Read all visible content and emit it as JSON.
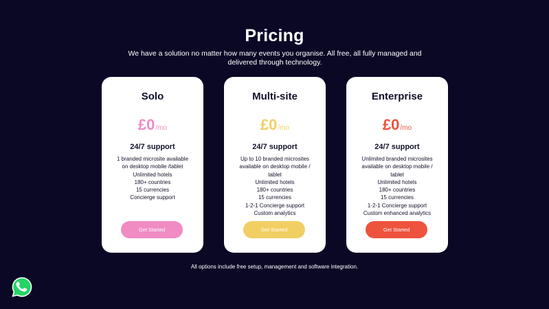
{
  "header": {
    "title": "Pricing",
    "subtitle": "We have a solution no matter how many events you organise. All free, all fully managed and delivered through technology."
  },
  "plans": [
    {
      "name": "Solo",
      "price": "£0",
      "period": "/mo",
      "support": "24/7 support",
      "accent": "#f08bc4",
      "features": [
        "1 branded microsite available",
        "on desktop mobile /tablet",
        "Unlimited hotels",
        "180+ countries",
        "15 currencies",
        "Concierge support"
      ],
      "cta": "Get Started"
    },
    {
      "name": "Multi-site",
      "price": "£0",
      "period": "/mo",
      "support": "24/7 support",
      "accent": "#f1cf62",
      "features": [
        "Up to 10 branded microsites",
        "available on desktop mobile /",
        "tablet",
        "Unlimited hotels",
        "180+ countries",
        "15 currencies",
        "1-2-1 Concierge support",
        "Custom analytics"
      ],
      "cta": "Get Started"
    },
    {
      "name": "Enterprise",
      "price": "£0",
      "period": "/mo",
      "support": "24/7 support",
      "accent": "#ee533d",
      "features": [
        "Unlimited branded microsites",
        "available on desktop mobile /",
        "tablet",
        "Unlimited hotels",
        "180+ countries",
        "15 currencies",
        "1-2-1 Concierge support",
        "Custom enhanced analytics"
      ],
      "cta": "Get Started"
    }
  ],
  "footnote": "All options include free setup, management and software integration.",
  "whatsapp": {
    "icon": "whatsapp-icon",
    "color": "#25d366"
  }
}
